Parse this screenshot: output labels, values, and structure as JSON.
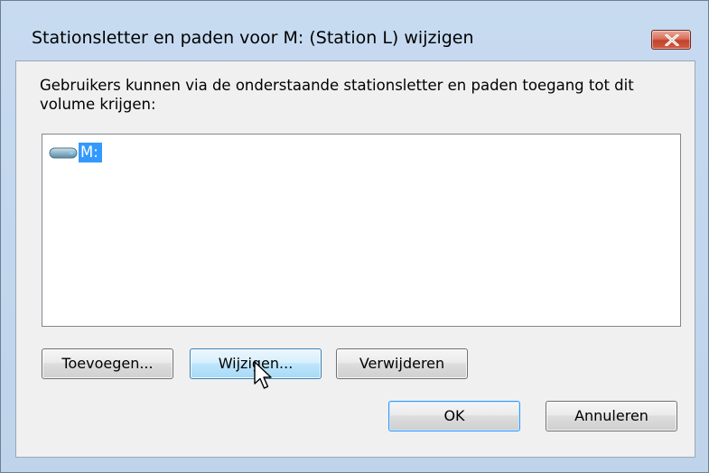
{
  "dialog": {
    "title": "Stationsletter en paden voor M: (Station L) wijzigen",
    "description": "Gebruikers kunnen via de onderstaande stationsletter en paden toegang tot dit volume krijgen:",
    "list_items": [
      {
        "label": "M:",
        "icon": "drive-icon",
        "selected": true
      }
    ],
    "buttons": {
      "add": "Toevoegen...",
      "change": "Wijzigen...",
      "remove": "Verwijderen",
      "ok": "OK",
      "cancel": "Annuleren"
    }
  },
  "colors": {
    "frame": "#c3d7ee",
    "client": "#f0f0f0",
    "selection": "#3399ff",
    "close_button": "#c2412c"
  }
}
